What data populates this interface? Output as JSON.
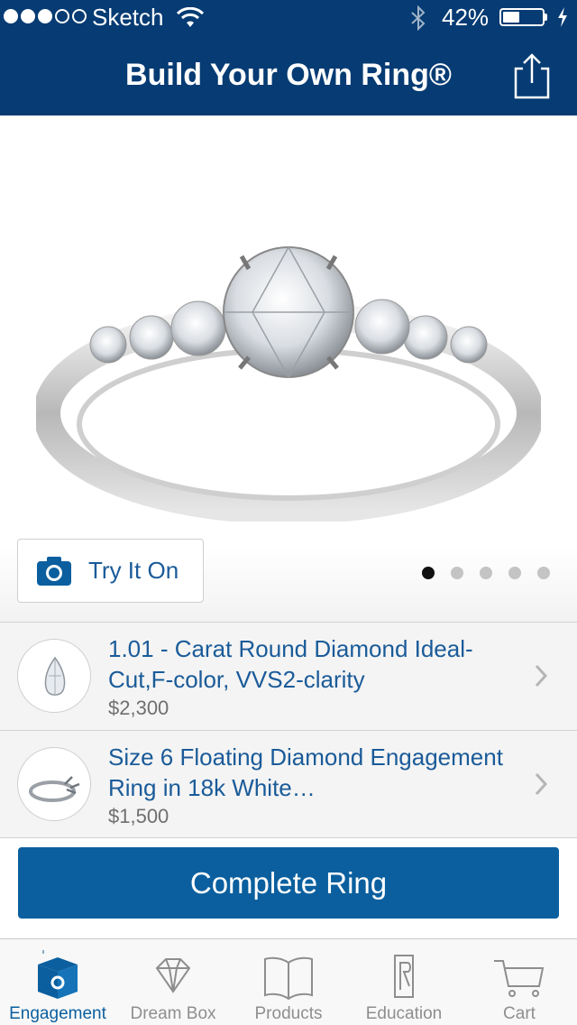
{
  "status_bar": {
    "carrier": "Sketch",
    "battery": "42%",
    "battery_level": 0.42
  },
  "header": {
    "title": "Build Your Own Ring®"
  },
  "hero": {
    "try_on_label": "Try It On",
    "page_count": 5,
    "active_page": 0
  },
  "items": [
    {
      "title": "1.01 - Carat Round Diamond Ideal-Cut,F-color, VVS2-clarity",
      "price": "$2,300"
    },
    {
      "title": "Size 6 Floating Diamond Engagement Ring in 18k White…",
      "price": "$1,500"
    }
  ],
  "complete_button": "Complete Ring",
  "tabs": [
    {
      "label": "Engagement",
      "icon": "ring-box-icon",
      "active": true
    },
    {
      "label": "Dream Box",
      "icon": "diamond-icon",
      "active": false
    },
    {
      "label": "Products",
      "icon": "book-icon",
      "active": false
    },
    {
      "label": "Education",
      "icon": "monogram-icon",
      "active": false
    },
    {
      "label": "Cart",
      "icon": "cart-icon",
      "active": false
    }
  ],
  "colors": {
    "nav": "#063b73",
    "accent": "#0b5f9e",
    "link": "#1a5b99"
  }
}
